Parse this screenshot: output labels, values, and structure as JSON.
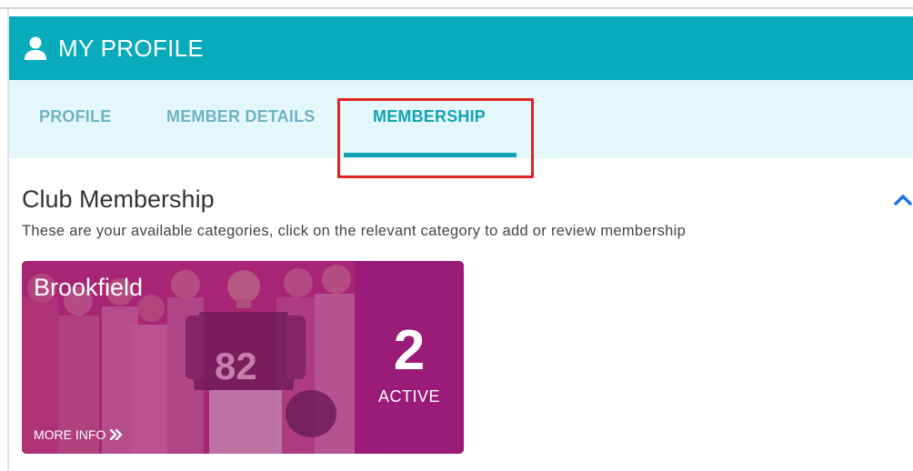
{
  "header": {
    "title": "MY PROFILE",
    "icon": "user-icon",
    "background_color": "#08abbb"
  },
  "tabs": [
    {
      "label": "PROFILE",
      "active": false
    },
    {
      "label": "MEMBER DETAILS",
      "active": false
    },
    {
      "label": "MEMBERSHIP",
      "active": true
    }
  ],
  "section": {
    "title": "Club Membership",
    "description": "These are your available categories, click on the relevant category to add or review membership",
    "collapse_icon": "chevron-up-icon"
  },
  "cards": [
    {
      "name": "Brookfield",
      "count": "2",
      "status": "ACTIVE",
      "more_info": "MORE INFO",
      "more_icon": "double-chevron-right-icon",
      "jersey_number": "82",
      "card_color": "#9a1b78"
    }
  ],
  "accent_color": "#13a3b6",
  "highlight_color": "#e02323"
}
